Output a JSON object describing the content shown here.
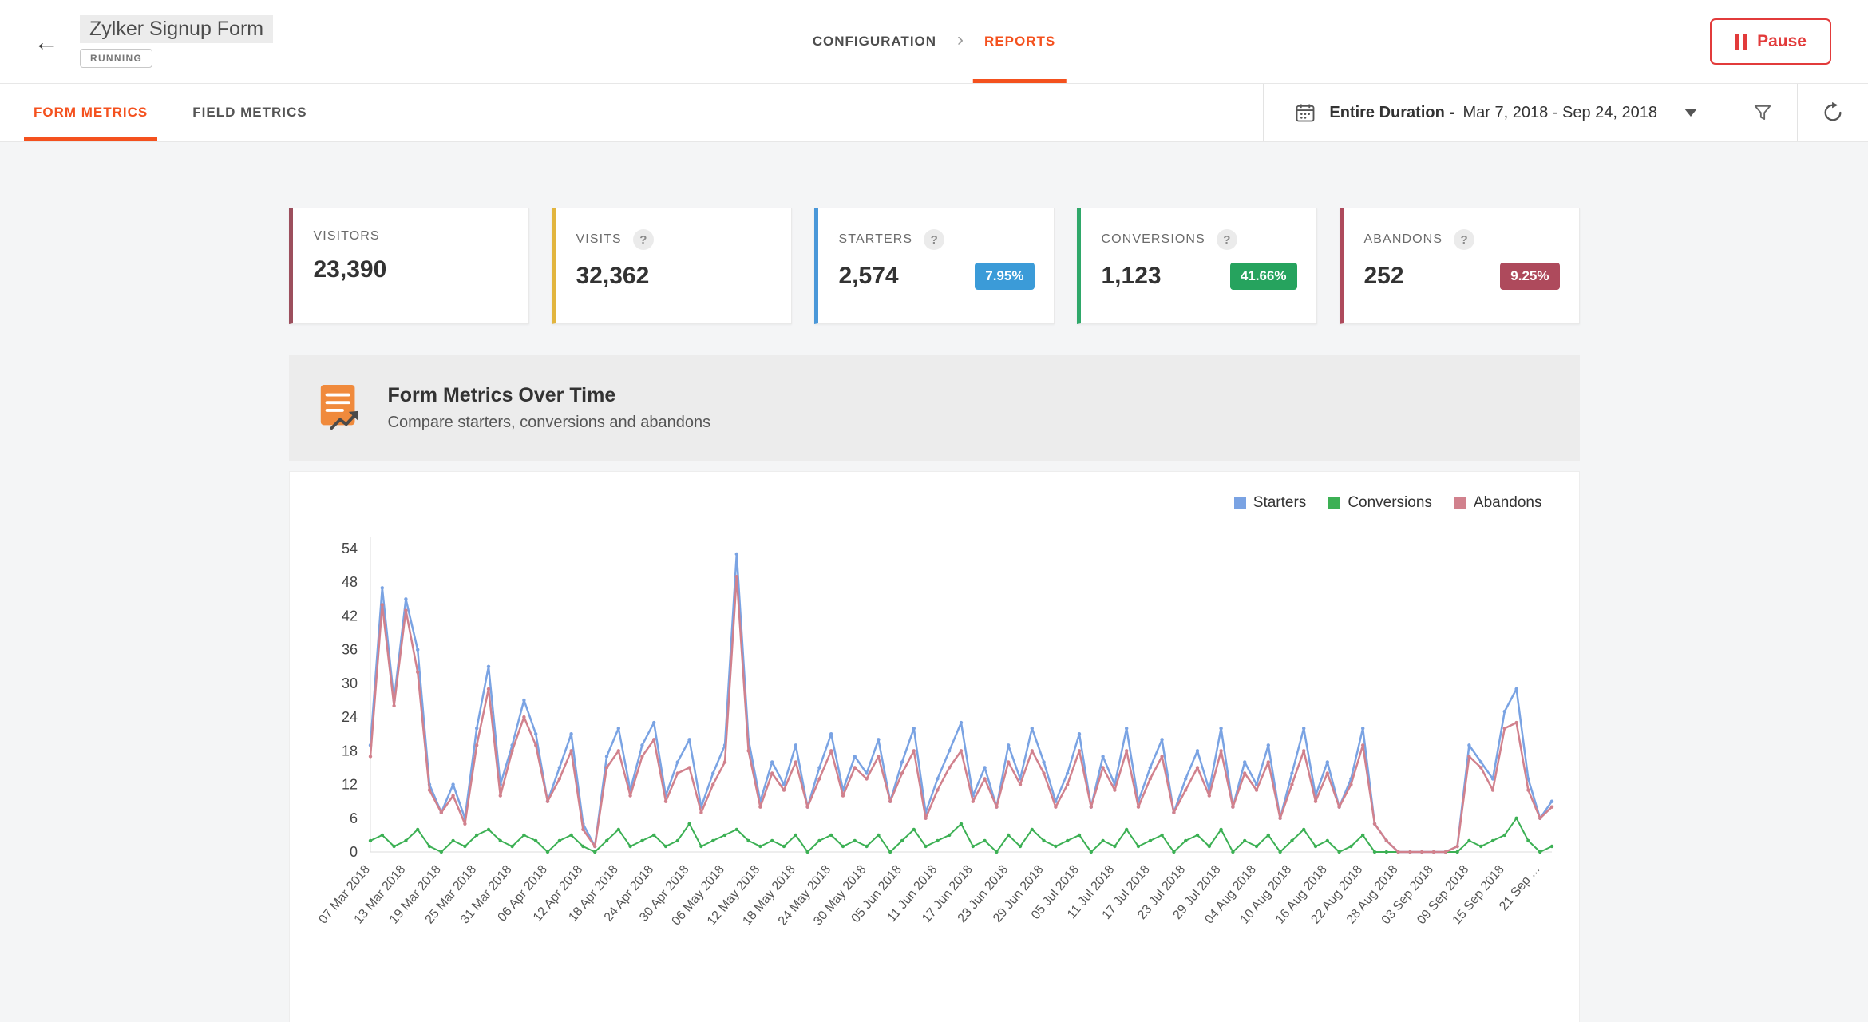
{
  "header": {
    "back_icon": "←",
    "title": "Zylker Signup Form",
    "status_badge": "RUNNING",
    "nav": {
      "configuration": "CONFIGURATION",
      "chevron": "›",
      "reports": "REPORTS"
    },
    "pause_button": "Pause"
  },
  "tabs": {
    "form_metrics": "FORM METRICS",
    "field_metrics": "FIELD METRICS"
  },
  "toolbar": {
    "date_range_label": "Entire Duration -",
    "date_range_value": "Mar 7, 2018 - Sep 24, 2018"
  },
  "cards": [
    {
      "label": "VISITORS",
      "value": "23,390",
      "accent": "#9c4f5d",
      "has_help": false
    },
    {
      "label": "VISITS",
      "value": "32,362",
      "accent": "#e2b53e",
      "has_help": true
    },
    {
      "label": "STARTERS",
      "value": "2,574",
      "accent": "#4a98d9",
      "has_help": true,
      "badge": "7.95%",
      "badge_color": "#3b9bd8"
    },
    {
      "label": "CONVERSIONS",
      "value": "1,123",
      "accent": "#2fa86a",
      "has_help": true,
      "badge": "41.66%",
      "badge_color": "#26a35e"
    },
    {
      "label": "ABANDONS",
      "value": "252",
      "accent": "#ae4a5c",
      "has_help": true,
      "badge": "9.25%",
      "badge_color": "#ae4a5c"
    }
  ],
  "section": {
    "title": "Form Metrics Over Time",
    "subtitle": "Compare starters, conversions and abandons"
  },
  "chart_data": {
    "type": "line",
    "title": "Form Metrics Over Time",
    "xlabel": "",
    "ylabel": "",
    "ylim": [
      0,
      54
    ],
    "yticks": [
      0,
      6,
      12,
      18,
      24,
      30,
      36,
      42,
      48,
      54
    ],
    "grid": false,
    "legend_position": "top-right",
    "points_per_tick": 3,
    "x_tick_labels": [
      "07 Mar 2018",
      "13 Mar 2018",
      "19 Mar 2018",
      "25 Mar 2018",
      "31 Mar 2018",
      "06 Apr 2018",
      "12 Apr 2018",
      "18 Apr 2018",
      "24 Apr 2018",
      "30 Apr 2018",
      "06 May 2018",
      "12 May 2018",
      "18 May 2018",
      "24 May 2018",
      "30 May 2018",
      "05 Jun 2018",
      "11 Jun 2018",
      "17 Jun 2018",
      "23 Jun 2018",
      "29 Jun 2018",
      "05 Jul 2018",
      "11 Jul 2018",
      "17 Jul 2018",
      "23 Jul 2018",
      "29 Jul 2018",
      "04 Aug 2018",
      "10 Aug 2018",
      "16 Aug 2018",
      "22 Aug 2018",
      "28 Aug 2018",
      "03 Sep 2018",
      "09 Sep 2018",
      "15 Sep 2018",
      "21 Sep ..."
    ],
    "series": [
      {
        "name": "Starters",
        "color": "#7aa3e3",
        "width": 2.5,
        "values": [
          19,
          47,
          27,
          45,
          36,
          12,
          7,
          12,
          6,
          22,
          33,
          12,
          19,
          27,
          21,
          9,
          15,
          21,
          5,
          1,
          17,
          22,
          11,
          19,
          23,
          10,
          16,
          20,
          8,
          14,
          19,
          53,
          20,
          9,
          16,
          12,
          19,
          8,
          15,
          21,
          11,
          17,
          14,
          20,
          9,
          16,
          22,
          7,
          13,
          18,
          23,
          10,
          15,
          8,
          19,
          13,
          22,
          16,
          9,
          14,
          21,
          8,
          17,
          12,
          22,
          9,
          15,
          20,
          7,
          13,
          18,
          11,
          22,
          8,
          16,
          12,
          19,
          6,
          14,
          22,
          10,
          16,
          8,
          13,
          22,
          5,
          2,
          0,
          0,
          0,
          0,
          0,
          1,
          19,
          16,
          13,
          25,
          29,
          13,
          6,
          9
        ]
      },
      {
        "name": "Conversions",
        "color": "#3cb054",
        "width": 2,
        "values": [
          2,
          3,
          1,
          2,
          4,
          1,
          0,
          2,
          1,
          3,
          4,
          2,
          1,
          3,
          2,
          0,
          2,
          3,
          1,
          0,
          2,
          4,
          1,
          2,
          3,
          1,
          2,
          5,
          1,
          2,
          3,
          4,
          2,
          1,
          2,
          1,
          3,
          0,
          2,
          3,
          1,
          2,
          1,
          3,
          0,
          2,
          4,
          1,
          2,
          3,
          5,
          1,
          2,
          0,
          3,
          1,
          4,
          2,
          1,
          2,
          3,
          0,
          2,
          1,
          4,
          1,
          2,
          3,
          0,
          2,
          3,
          1,
          4,
          0,
          2,
          1,
          3,
          0,
          2,
          4,
          1,
          2,
          0,
          1,
          3,
          0,
          0,
          0,
          0,
          0,
          0,
          0,
          0,
          2,
          1,
          2,
          3,
          6,
          2,
          0,
          1
        ]
      },
      {
        "name": "Abandons",
        "color": "#d1818d",
        "width": 2.5,
        "values": [
          17,
          44,
          26,
          43,
          32,
          11,
          7,
          10,
          5,
          19,
          29,
          10,
          18,
          24,
          19,
          9,
          13,
          18,
          4,
          1,
          15,
          18,
          10,
          17,
          20,
          9,
          14,
          15,
          7,
          12,
          16,
          49,
          18,
          8,
          14,
          11,
          16,
          8,
          13,
          18,
          10,
          15,
          13,
          17,
          9,
          14,
          18,
          6,
          11,
          15,
          18,
          9,
          13,
          8,
          16,
          12,
          18,
          14,
          8,
          12,
          18,
          8,
          15,
          11,
          18,
          8,
          13,
          17,
          7,
          11,
          15,
          10,
          18,
          8,
          14,
          11,
          16,
          6,
          12,
          18,
          9,
          14,
          8,
          12,
          19,
          5,
          2,
          0,
          0,
          0,
          0,
          0,
          1,
          17,
          15,
          11,
          22,
          23,
          11,
          6,
          8
        ]
      }
    ]
  }
}
